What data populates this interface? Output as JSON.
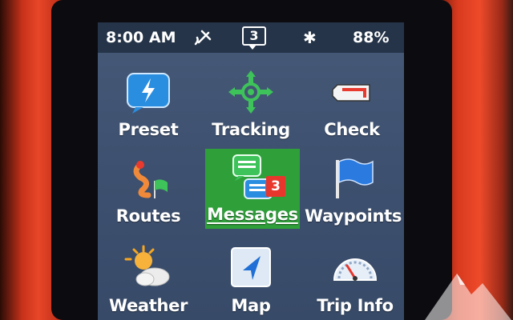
{
  "status_bar": {
    "time": "8:00 AM",
    "unread_count": "3",
    "battery": "88%",
    "icons": [
      "satellite-icon",
      "message-icon",
      "bluetooth-icon"
    ]
  },
  "menu": {
    "selected": "Messages",
    "items": [
      {
        "label": "Preset",
        "icon": "preset-lightning-icon"
      },
      {
        "label": "Tracking",
        "icon": "tracking-crosshair-icon"
      },
      {
        "label": "Check",
        "icon": "check-in-icon"
      },
      {
        "label": "Routes",
        "icon": "routes-icon"
      },
      {
        "label": "Messages",
        "icon": "messages-icon",
        "badge": "3"
      },
      {
        "label": "Waypoints",
        "icon": "waypoint-flag-icon"
      },
      {
        "label": "Weather",
        "icon": "weather-icon"
      },
      {
        "label": "Map",
        "icon": "map-icon"
      },
      {
        "label": "Trip Info",
        "icon": "trip-info-gauge-icon"
      }
    ]
  },
  "colors": {
    "device_red": "#e84628",
    "screen_bg": "#3e5170",
    "selected_bg": "#2f9f3a",
    "badge_red": "#e8362c"
  }
}
